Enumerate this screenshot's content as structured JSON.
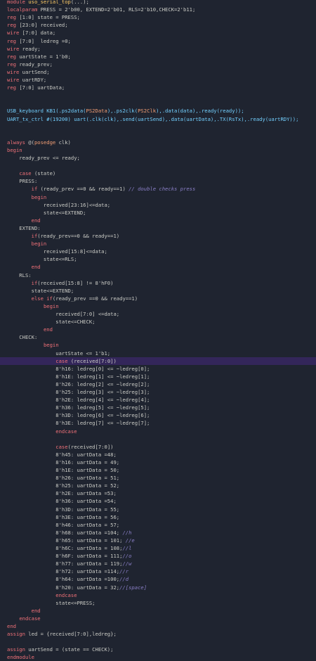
{
  "editor": {
    "theme": {
      "background": "#1f2430",
      "highlight": "#33265a"
    },
    "highlighted_line": 46,
    "lines": [
      [
        [
          "module ",
          "kw"
        ],
        [
          "uso_serial_top",
          "fn"
        ],
        [
          "(...);",
          "pu"
        ]
      ],
      [
        [
          "localparam ",
          "kw"
        ],
        [
          "PRESS = 2'b00, EXTEND=2'b01, RLS=2'b10,CHECK=2'b11;",
          "id"
        ]
      ],
      [
        [
          "reg ",
          "kw"
        ],
        [
          "[1:0] state = PRESS;",
          "id"
        ]
      ],
      [
        [
          "reg ",
          "kw"
        ],
        [
          "[23:0] received;",
          "id"
        ]
      ],
      [
        [
          "wire ",
          "kw"
        ],
        [
          "[7:0] data;",
          "id"
        ]
      ],
      [
        [
          "reg ",
          "kw"
        ],
        [
          "[7:0]  ledreg =0;",
          "id"
        ]
      ],
      [
        [
          "wire ",
          "kw"
        ],
        [
          "ready;",
          "id"
        ]
      ],
      [
        [
          "reg ",
          "kw"
        ],
        [
          "uartState = 1'b0;",
          "id"
        ]
      ],
      [
        [
          "reg ",
          "kw"
        ],
        [
          "ready_prev;",
          "id"
        ]
      ],
      [
        [
          "wire ",
          "kw"
        ],
        [
          "uartSend;",
          "id"
        ]
      ],
      [
        [
          "wire ",
          "kw"
        ],
        [
          "uartRDY;",
          "id"
        ]
      ],
      [
        [
          "reg ",
          "kw"
        ],
        [
          "[7:0] uartData;",
          "id"
        ]
      ],
      [
        [
          "",
          "id"
        ]
      ],
      [
        [
          "",
          "id"
        ]
      ],
      [
        [
          "USB_keyboard KB1(.ps2data(",
          "mo"
        ],
        [
          "PS2Data",
          "op"
        ],
        [
          "),.ps2clk(",
          "mo"
        ],
        [
          "PS2Clk",
          "op"
        ],
        [
          "),.data(data),.ready(ready));",
          "mo"
        ]
      ],
      [
        [
          "UART_tx_ctrl #(19200) uart(.clk(clk),.send(uartSend),.data(uartData),.TX(RsTx),.ready(uartRDY));",
          "mo"
        ]
      ],
      [
        [
          "",
          "id"
        ]
      ],
      [
        [
          "",
          "id"
        ]
      ],
      [
        [
          "always ",
          "kw"
        ],
        [
          "@(",
          "pu"
        ],
        [
          "posedge ",
          "op"
        ],
        [
          "clk)",
          "id"
        ]
      ],
      [
        [
          "begin",
          "kw"
        ]
      ],
      [
        [
          "    ready_prev <= ready;",
          "id"
        ]
      ],
      [
        [
          "",
          "id"
        ]
      ],
      [
        [
          "    ",
          "id"
        ],
        [
          "case ",
          "kw"
        ],
        [
          "(state)",
          "id"
        ]
      ],
      [
        [
          "    PRESS:",
          "id"
        ]
      ],
      [
        [
          "        ",
          "id"
        ],
        [
          "if ",
          "kw"
        ],
        [
          "(ready_prev ==0 && ready==1) ",
          "id"
        ],
        [
          "// double checks press",
          "co"
        ]
      ],
      [
        [
          "        ",
          "id"
        ],
        [
          "begin",
          "kw"
        ]
      ],
      [
        [
          "            received[23:16]<=data;",
          "id"
        ]
      ],
      [
        [
          "            state<=EXTEND;",
          "id"
        ]
      ],
      [
        [
          "        ",
          "id"
        ],
        [
          "end",
          "kw"
        ]
      ],
      [
        [
          "    EXTEND:",
          "id"
        ]
      ],
      [
        [
          "        ",
          "id"
        ],
        [
          "if",
          "kw"
        ],
        [
          "(ready_prev==0 && ready==1)",
          "id"
        ]
      ],
      [
        [
          "        ",
          "id"
        ],
        [
          "begin",
          "kw"
        ]
      ],
      [
        [
          "            received[15:8]<=data;",
          "id"
        ]
      ],
      [
        [
          "            state<=RLS;",
          "id"
        ]
      ],
      [
        [
          "        ",
          "id"
        ],
        [
          "end",
          "kw"
        ]
      ],
      [
        [
          "    RLS:",
          "id"
        ]
      ],
      [
        [
          "        ",
          "id"
        ],
        [
          "if",
          "kw"
        ],
        [
          "(received[15:8] != 8'hF0)",
          "id"
        ]
      ],
      [
        [
          "        state<=EXTEND;",
          "id"
        ]
      ],
      [
        [
          "        ",
          "id"
        ],
        [
          "else if",
          "kw"
        ],
        [
          "(ready_prev ==0 && ready==1)",
          "id"
        ]
      ],
      [
        [
          "            ",
          "id"
        ],
        [
          "begin",
          "kw"
        ]
      ],
      [
        [
          "                received[7:0] <=data;",
          "id"
        ]
      ],
      [
        [
          "                state<=CHECK;",
          "id"
        ]
      ],
      [
        [
          "            ",
          "id"
        ],
        [
          "end",
          "kw"
        ]
      ],
      [
        [
          "    CHECK:",
          "id"
        ]
      ],
      [
        [
          "            ",
          "id"
        ],
        [
          "begin",
          "kw"
        ]
      ],
      [
        [
          "                uartState <= 1'b1;",
          "id"
        ]
      ],
      [
        [
          "                ",
          "id"
        ],
        [
          "case ",
          "kw"
        ],
        [
          "(received[7:0])",
          "id"
        ]
      ],
      [
        [
          "                8'h16: ledreg[0] <= ~ledreg[0];",
          "id"
        ]
      ],
      [
        [
          "                8'h1E: ledreg[1] <= ~ledreg[1];",
          "id"
        ]
      ],
      [
        [
          "                8'h26: ledreg[2] <= ~ledreg[2];",
          "id"
        ]
      ],
      [
        [
          "                8'h25: ledreg[3] <= ~ledreg[3];",
          "id"
        ]
      ],
      [
        [
          "                8'h2E: ledreg[4] <= ~ledreg[4];",
          "id"
        ]
      ],
      [
        [
          "                8'h36: ledreg[5] <= ~ledreg[5];",
          "id"
        ]
      ],
      [
        [
          "                8'h3D: ledreg[6] <= ~ledreg[6];",
          "id"
        ]
      ],
      [
        [
          "                8'h3E: ledreg[7] <= ~ledreg[7];",
          "id"
        ]
      ],
      [
        [
          "                ",
          "id"
        ],
        [
          "endcase",
          "kw"
        ]
      ],
      [
        [
          "",
          "id"
        ]
      ],
      [
        [
          "                ",
          "id"
        ],
        [
          "case",
          "kw"
        ],
        [
          "(received[7:0])",
          "id"
        ]
      ],
      [
        [
          "                8'h45: uartData =48;",
          "id"
        ]
      ],
      [
        [
          "                8'h16: uartData = 49;",
          "id"
        ]
      ],
      [
        [
          "                8'h1E: uartData = 50;",
          "id"
        ]
      ],
      [
        [
          "                8'h26: uartData = 51;",
          "id"
        ]
      ],
      [
        [
          "                8'h25: uartData = 52;",
          "id"
        ]
      ],
      [
        [
          "                8'h2E: uartData =53;",
          "id"
        ]
      ],
      [
        [
          "                8'h36: uartData =54;",
          "id"
        ]
      ],
      [
        [
          "                8'h3D: uartData = 55;",
          "id"
        ]
      ],
      [
        [
          "                8'h3E: uartData = 56;",
          "id"
        ]
      ],
      [
        [
          "                8'h46: uartData = 57;",
          "id"
        ]
      ],
      [
        [
          "                8'h68: uartData =104; ",
          "id"
        ],
        [
          "//h",
          "co"
        ]
      ],
      [
        [
          "                8'h65: uartData = 101; ",
          "id"
        ],
        [
          "//e",
          "co"
        ]
      ],
      [
        [
          "                8'h6C: uartData = 108;",
          "id"
        ],
        [
          "//l",
          "co"
        ]
      ],
      [
        [
          "                8'h6F: uartData = 111;",
          "id"
        ],
        [
          "//o",
          "co"
        ]
      ],
      [
        [
          "                8'h77: uartData = 119;",
          "id"
        ],
        [
          "//w",
          "co"
        ]
      ],
      [
        [
          "                8'h72: uartData =114;",
          "id"
        ],
        [
          "//r",
          "co"
        ]
      ],
      [
        [
          "                8'h64: uartData =100;",
          "id"
        ],
        [
          "//d",
          "co"
        ]
      ],
      [
        [
          "                8'h20: uartData = 32;",
          "id"
        ],
        [
          "//[space]",
          "co"
        ]
      ],
      [
        [
          "                ",
          "id"
        ],
        [
          "endcase",
          "kw"
        ]
      ],
      [
        [
          "                state<=PRESS;",
          "id"
        ]
      ],
      [
        [
          "        ",
          "id"
        ],
        [
          "end",
          "kw"
        ]
      ],
      [
        [
          "    ",
          "id"
        ],
        [
          "endcase",
          "kw"
        ]
      ],
      [
        [
          "end",
          "kw"
        ]
      ],
      [
        [
          "assign ",
          "kw"
        ],
        [
          "led = {received[7:0],ledreg};",
          "id"
        ]
      ],
      [
        [
          "",
          "id"
        ]
      ],
      [
        [
          "assign ",
          "kw"
        ],
        [
          "uartSend = (state == CHECK);",
          "id"
        ]
      ],
      [
        [
          "endmodule",
          "kw"
        ]
      ]
    ]
  }
}
